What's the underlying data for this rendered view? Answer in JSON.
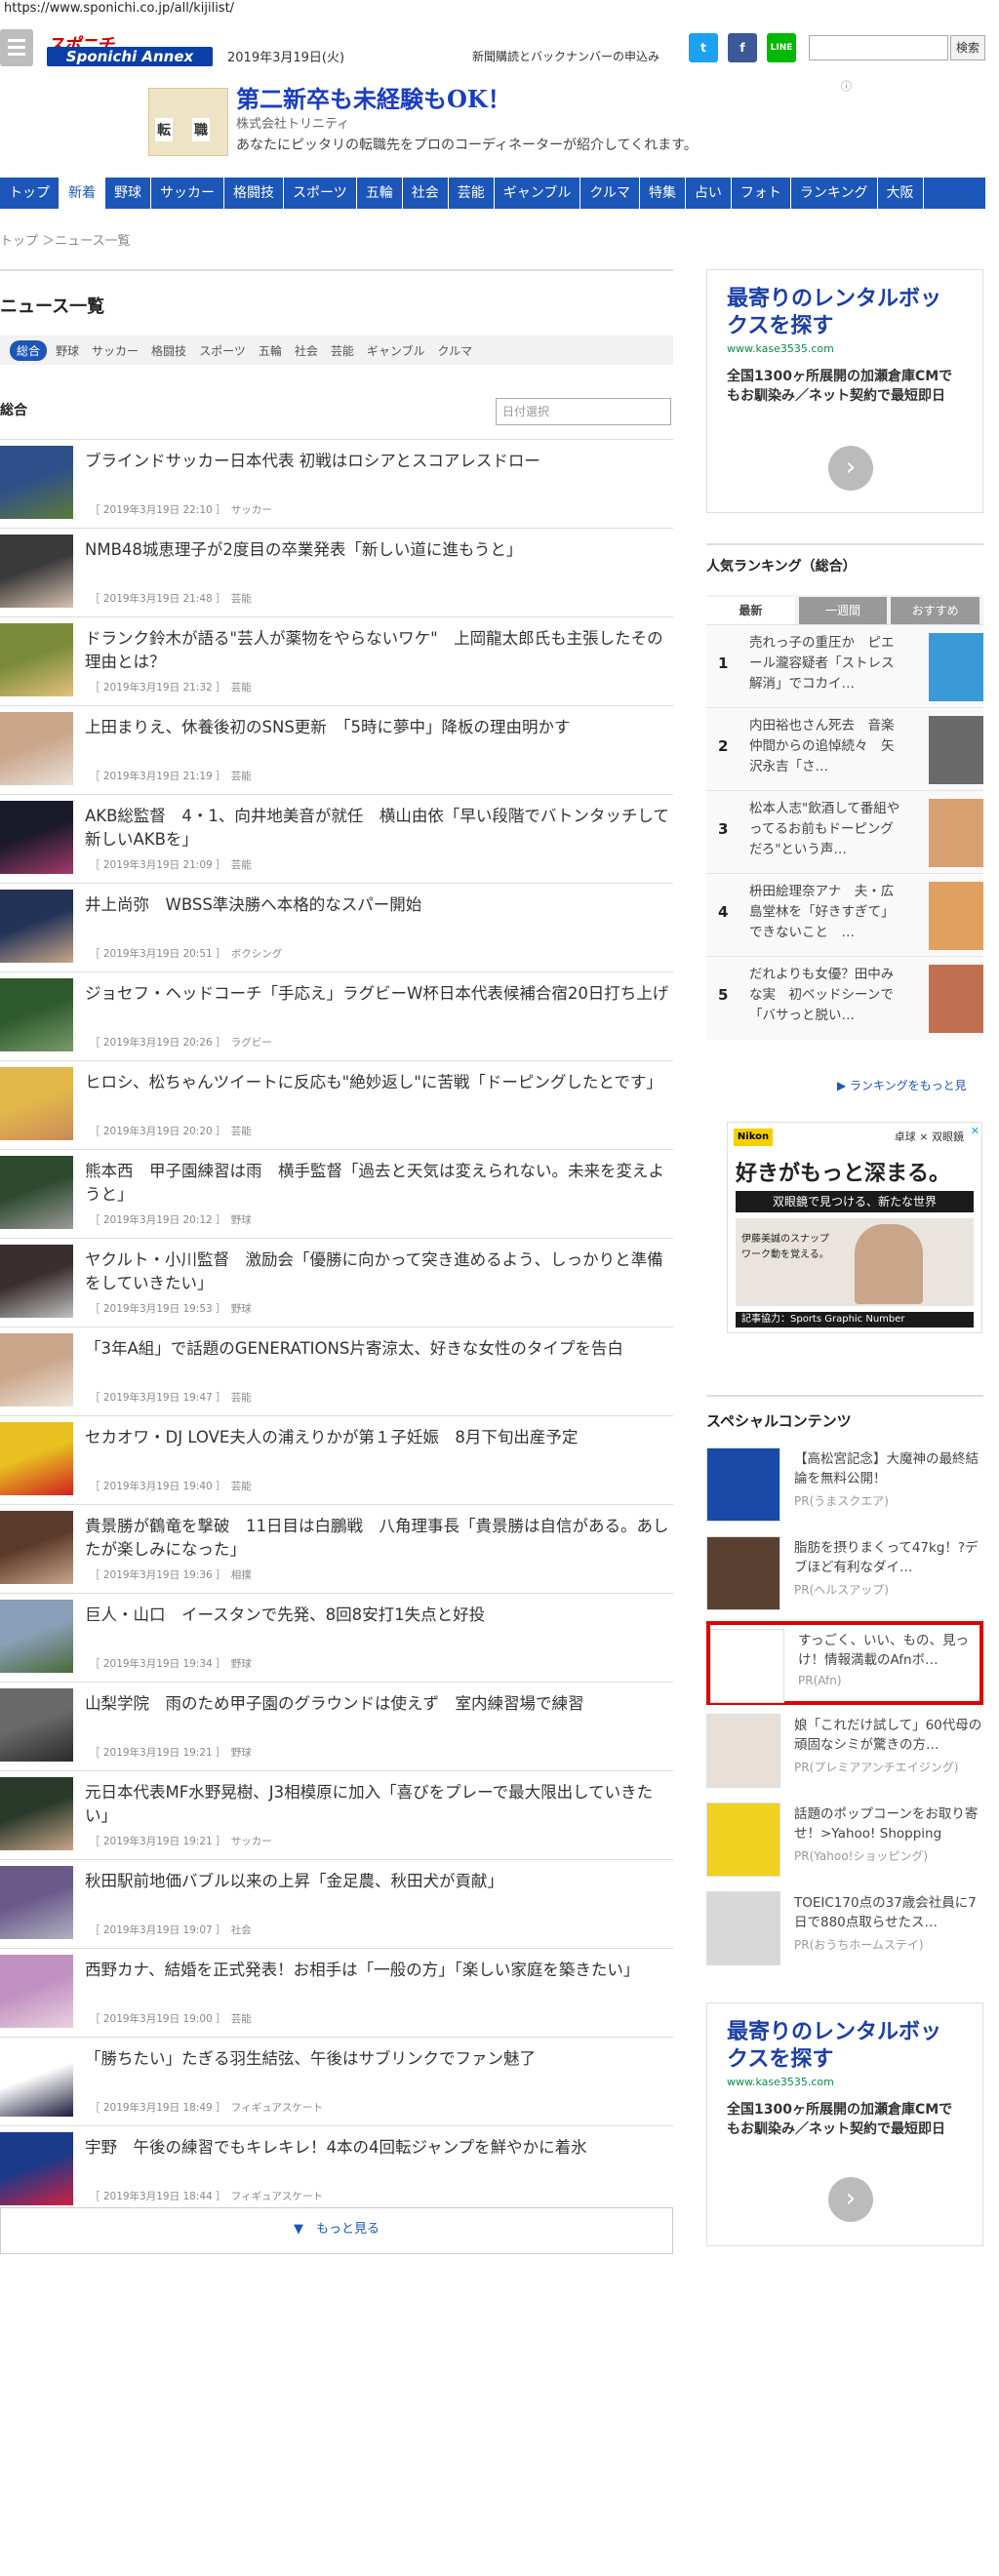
{
  "browser": {
    "url": "https://www.sponichi.co.jp/all/kijilist/"
  },
  "header": {
    "logo_top": "スポニチ",
    "logo_main": "Sponichi Annex",
    "date": "2019年3月19日(火)",
    "subscribe_link": "新聞購読とバックナンバーの申込み",
    "social": [
      {
        "name": "twitter",
        "label": "t",
        "color": "#1da1f2"
      },
      {
        "name": "facebook",
        "label": "f",
        "color": "#3b5998"
      },
      {
        "name": "line",
        "label": "LINE",
        "color": "#00b900"
      }
    ],
    "search_button": "検索"
  },
  "ad_top": {
    "title": "第二新卒も未経験もOK！",
    "company": "株式会社トリニティ",
    "description": "あなたにピッタリの転職先をプロのコーディネーターが紹介してくれます。",
    "image_chars": [
      "転",
      "職"
    ]
  },
  "nav": [
    "トップ",
    "新着",
    "野球",
    "サッカー",
    "格闘技",
    "スポーツ",
    "五輪",
    "社会",
    "芸能",
    "ギャンブル",
    "クルマ",
    "特集",
    "占い",
    "フォト",
    "ランキング",
    "大阪"
  ],
  "nav_active": 1,
  "breadcrumb": "トップ ＞ニュース一覧",
  "page_title": "ニュース一覧",
  "categories": [
    "総合",
    "野球",
    "サッカー",
    "格闘技",
    "スポーツ",
    "五輪",
    "社会",
    "芸能",
    "ギャンブル",
    "クルマ"
  ],
  "section_title": "総合",
  "date_select": "日付選択",
  "news": [
    {
      "title": "ブラインドサッカー日本代表 初戦はロシアとスコアレスドロー",
      "date": "［ 2019年3月19日 22:10 ］",
      "cat": "サッカー"
    },
    {
      "title": "NMB48城恵理子が2度目の卒業発表「新しい道に進もうと」",
      "date": "［ 2019年3月19日 21:48 ］",
      "cat": "芸能"
    },
    {
      "title": "ドランク鈴木が語る\"芸人が薬物をやらないワケ\"　上岡龍太郎氏も主張したその理由とは？",
      "date": "［ 2019年3月19日 21:32 ］",
      "cat": "芸能"
    },
    {
      "title": "上田まりえ、休養後初のSNS更新　「5時に夢中」降板の理由明かす",
      "date": "［ 2019年3月19日 21:19 ］",
      "cat": "芸能"
    },
    {
      "title": "AKB総監督　4・1、向井地美音が就任　横山由依「早い段階でバトンタッチして新しいAKBを」",
      "date": "［ 2019年3月19日 21:09 ］",
      "cat": "芸能"
    },
    {
      "title": "井上尚弥　WBSS準決勝へ本格的なスパー開始",
      "date": "［ 2019年3月19日 20:51 ］",
      "cat": "ボクシング"
    },
    {
      "title": "ジョセフ・ヘッドコーチ「手応え」ラグビーW杯日本代表候補合宿20日打ち上げ",
      "date": "［ 2019年3月19日 20:26 ］",
      "cat": "ラグビー"
    },
    {
      "title": "ヒロシ、松ちゃんツイートに反応も\"絶妙返し\"に苦戦「ドーピングしたとです」",
      "date": "［ 2019年3月19日 20:20 ］",
      "cat": "芸能"
    },
    {
      "title": "熊本西　甲子園練習は雨　横手監督「過去と天気は変えられない。未来を変えようと」",
      "date": "［ 2019年3月19日 20:12 ］",
      "cat": "野球"
    },
    {
      "title": "ヤクルト・小川監督　激励会「優勝に向かって突き進めるよう、しっかりと準備をしていきたい」",
      "date": "［ 2019年3月19日 19:53 ］",
      "cat": "野球"
    },
    {
      "title": "「3年A組」で話題のGENERATIONS片寄涼太、好きな女性のタイプを告白",
      "date": "［ 2019年3月19日 19:47 ］",
      "cat": "芸能"
    },
    {
      "title": "セカオワ・DJ LOVE夫人の浦えりかが第１子妊娠　8月下旬出産予定",
      "date": "［ 2019年3月19日 19:40 ］",
      "cat": "芸能"
    },
    {
      "title": "貴景勝が鶴竜を撃破　11日目は白鵬戦　八角理事長「貴景勝は自信がある。あしたが楽しみになった」",
      "date": "［ 2019年3月19日 19:36 ］",
      "cat": "相撲"
    },
    {
      "title": "巨人・山口　イースタンで先発、8回8安打1失点と好投",
      "date": "［ 2019年3月19日 19:34 ］",
      "cat": "野球"
    },
    {
      "title": "山梨学院　雨のため甲子園のグラウンドは使えず　室内練習場で練習",
      "date": "［ 2019年3月19日 19:21 ］",
      "cat": "野球"
    },
    {
      "title": "元日本代表MF水野晃樹、J3相模原に加入「喜びをプレーで最大限出していきたい」",
      "date": "［ 2019年3月19日 19:21 ］",
      "cat": "サッカー"
    },
    {
      "title": "秋田駅前地価バブル以来の上昇「金足農、秋田犬が貢献」",
      "date": "［ 2019年3月19日 19:07 ］",
      "cat": "社会"
    },
    {
      "title": "西野カナ、結婚を正式発表！お相手は「一般の方」「楽しい家庭を築きたい」",
      "date": "［ 2019年3月19日 19:00 ］",
      "cat": "芸能"
    },
    {
      "title": "「勝ちたい」たぎる羽生結弦、午後はサブリンクでファン魅了",
      "date": "［ 2019年3月19日 18:49 ］",
      "cat": "フィギュアスケート"
    },
    {
      "title": "宇野　午後の練習でもキレキレ！4本の4回転ジャンプを鮮やかに着氷",
      "date": "［ 2019年3月19日 18:44 ］",
      "cat": "フィギュアスケート"
    }
  ],
  "more_button": "▼　もっと見る",
  "side_ad": {
    "title": "最寄りのレンタルボックスを探す",
    "url": "www.kase3535.com",
    "description": "全国1300ヶ所展開の加瀬倉庫CMでもお馴染み／ネット契約で最短即日",
    "arrow": "›"
  },
  "ranking": {
    "title": "人気ランキング（総合）",
    "tabs": [
      "最新",
      "一週間",
      "おすすめ"
    ],
    "items": [
      {
        "n": "1",
        "text": "売れっ子の重圧か　ピエール瀧容疑者「ストレス解消」でコカイ…"
      },
      {
        "n": "2",
        "text": "内田裕也さん死去　音楽仲間からの追悼続々　矢沢永吉「さ…"
      },
      {
        "n": "3",
        "text": "松本人志\"飲酒して番組やってるお前もドーピングだろ\"という声…"
      },
      {
        "n": "4",
        "text": "枡田絵理奈アナ　夫・広島堂林を「好きすぎて」できないこと　…"
      },
      {
        "n": "5",
        "text": "だれよりも女優？田中みな実　初ベッドシーンで「バサっと脱い…"
      }
    ],
    "more": "▶ ランキングをもっと見"
  },
  "nikon_ad": {
    "brand": "Nikon",
    "tag": "卓球 × 双眼鏡",
    "headline": "好きがもっと深まる。",
    "sub": "双眼鏡で見つける、新たな世界",
    "caption": "伊藤美誠のスナップワーク動を覚える。",
    "footer": "記事協力：Sports Graphic Number"
  },
  "special": {
    "title": "スペシャルコンテンツ",
    "items": [
      {
        "text": "【高松宮記念】大魔神の最終結論を無料公開！",
        "pr": "PR(うまスクエア)"
      },
      {
        "text": "脂肪を摂りまくって47kg！?デブほど有利なダイ…",
        "pr": "PR(ヘルスアップ)"
      },
      {
        "text": "すっごく、いい、もの、見っけ！情報満載のAfnボ…",
        "pr": "PR(Afn)"
      },
      {
        "text": "娘「これだけ試して」60代母の頑固なシミが驚きの方…",
        "pr": "PR(プレミアアンチエイジング)"
      },
      {
        "text": "話題のポップコーンをお取り寄せ！>Yahoo! Shopping",
        "pr": "PR(Yahoo!ショッピング)"
      },
      {
        "text": "TOEIC170点の37歳会社員に7日で880点取らせたス…",
        "pr": "PR(おうちホームステイ)"
      }
    ]
  }
}
